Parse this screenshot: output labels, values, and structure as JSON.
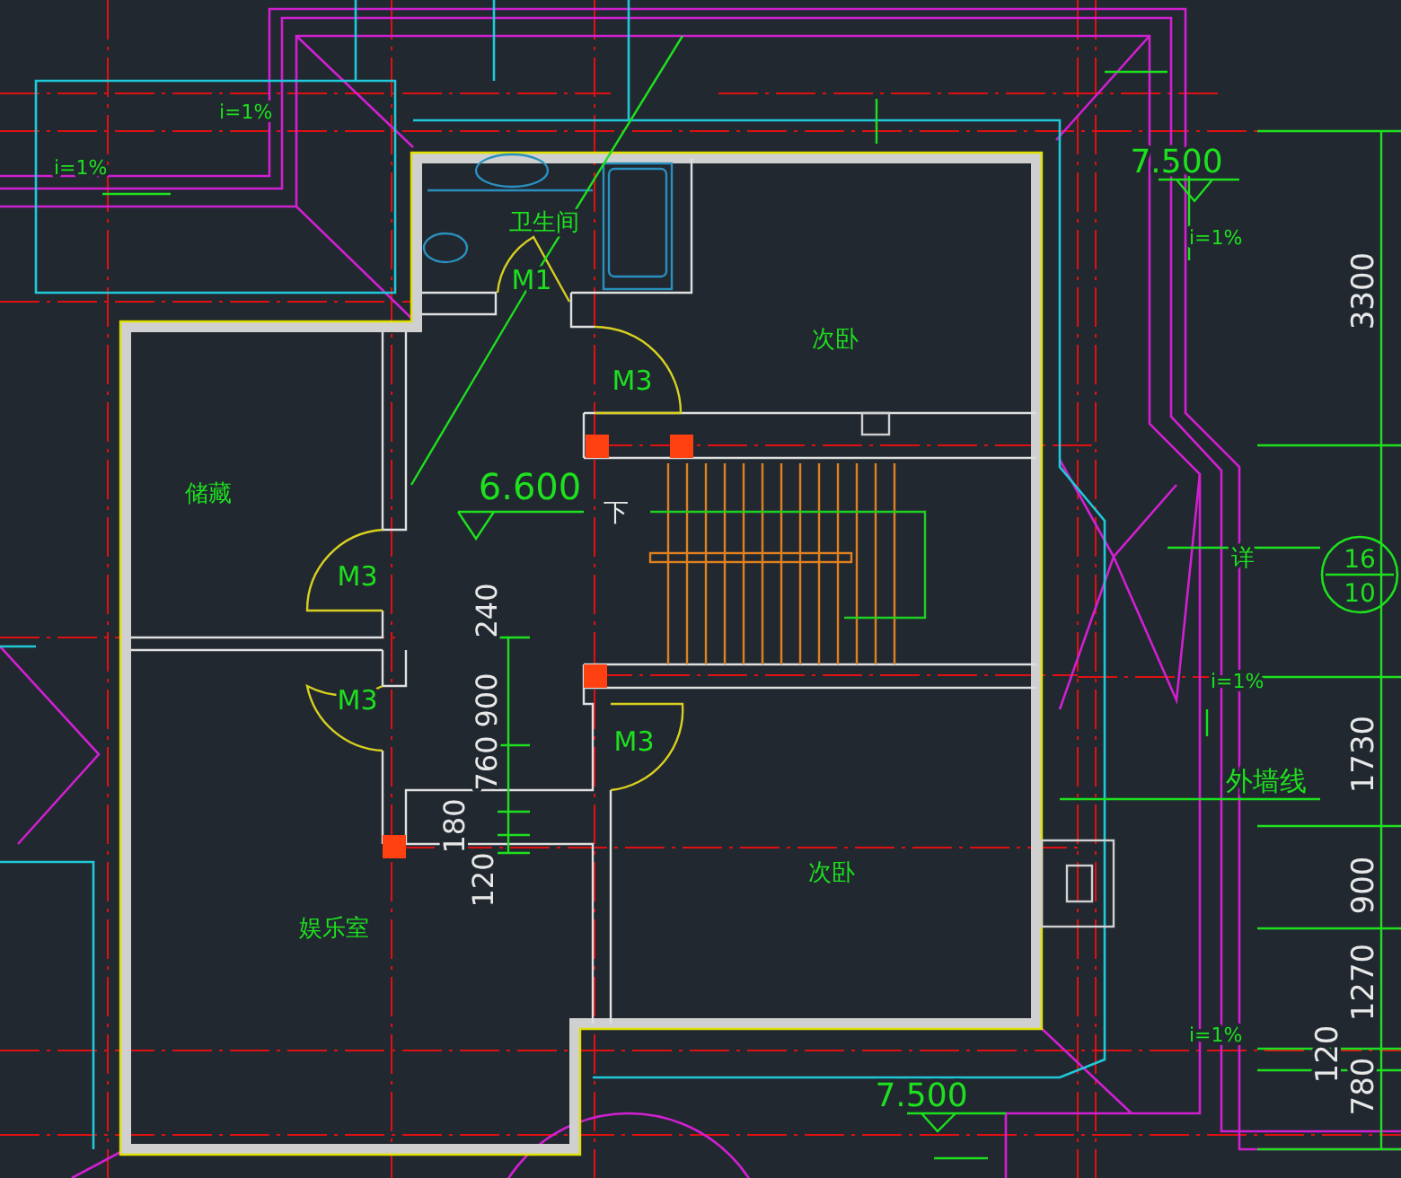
{
  "rooms": [
    {
      "name": "卫生间"
    },
    {
      "name": "次卧"
    },
    {
      "name": "储藏"
    },
    {
      "name": "次卧"
    },
    {
      "name": "娱乐室"
    }
  ],
  "doors": [
    "M1",
    "M3",
    "M3",
    "M3",
    "M3"
  ],
  "floor_elevation": "6.600",
  "stair_direction": "下",
  "roof_elevations": [
    "7.500",
    "7.500"
  ],
  "slopes": [
    "i=1%",
    "i=1%",
    "i=1%",
    "i=1%",
    "i=1%"
  ],
  "inner_dimensions": [
    "240",
    "900",
    "760",
    "180",
    "120"
  ],
  "outer_dimensions": [
    "3300",
    "1730",
    "900",
    "1270",
    "120",
    "780"
  ],
  "wall_note": "外墙线",
  "detail_callout": {
    "prefix": "详",
    "number": "16",
    "sheet": "10"
  }
}
